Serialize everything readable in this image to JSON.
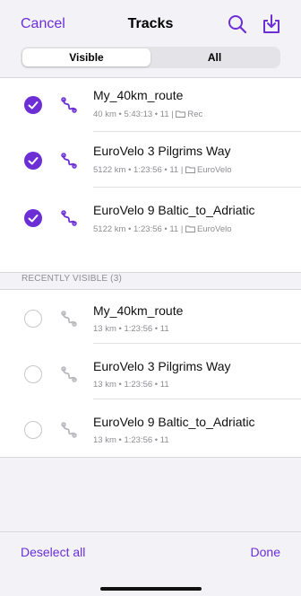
{
  "header": {
    "cancel_label": "Cancel",
    "title": "Tracks",
    "search_icon": "search-icon",
    "import_icon": "import-icon"
  },
  "tabs": [
    {
      "label": "Visible",
      "selected": true
    },
    {
      "label": "All",
      "selected": false
    }
  ],
  "visible_tracks": [
    {
      "name": "My_40km_route",
      "meta": "40 km  •  5:43:13  •  11  |",
      "folder": "Rec",
      "checked": true
    },
    {
      "name": "EuroVelo 3 Pilgrims Way",
      "meta": "5122 km  •  1:23:56  •  11  |",
      "folder": "EuroVelo",
      "checked": true
    },
    {
      "name": "EuroVelo 9 Baltic_to_Adriatic",
      "meta": "5122 km  •  1:23:56  •  11  |",
      "folder": "EuroVelo",
      "checked": true
    }
  ],
  "recent_section_label": "RECENTLY VISIBLE (3)",
  "recent_tracks": [
    {
      "name": "My_40km_route",
      "meta": "13 km • 1:23:56 • 11",
      "checked": false
    },
    {
      "name": "EuroVelo 3 Pilgrims Way",
      "meta": "13 km • 1:23:56 • 11",
      "checked": false
    },
    {
      "name": "EuroVelo 9 Baltic_to_Adriatic",
      "meta": "13 km • 1:23:56 • 11",
      "checked": false
    }
  ],
  "footer": {
    "deselect_label": "Deselect all",
    "done_label": "Done"
  },
  "colors": {
    "accent": "#6c2fd6",
    "route_icon_active": "#6c2fd6",
    "route_icon_inactive": "#b8b8bd"
  }
}
